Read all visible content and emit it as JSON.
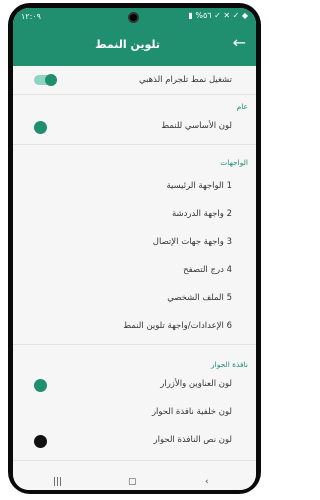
{
  "status": {
    "time": "١٢:٠٩",
    "icons": "▮ %٥٦ ✓ ✕ ✓ ◆"
  },
  "appbar": {
    "title": "تلوين النمط",
    "back_icon": "arrow-left-icon"
  },
  "settings": {
    "enable_label": "تشغيل نمط تلجرام الذهبي",
    "enable_state": "on",
    "section_general": "عام",
    "base_color_label": "لون الأساسي للنمط",
    "section_interfaces": "الواجهات",
    "interfaces": [
      "1 الواجهة الرئيسية",
      "2 واجهة الدردشة",
      "3 واجهة جهات الإتصال",
      "4 درج التصفح",
      "5 الملف الشخصي",
      "6 الإعدادات/واجهة تلوين النمط"
    ],
    "section_dialog": "نافذة الحوار",
    "dialog_items": [
      {
        "label": "لون العناوين والأزرار",
        "color": "#1f8f6f"
      },
      {
        "label": "لون خلفية نافذة الحوار",
        "color": ""
      },
      {
        "label": "لون نص النافذة الحوار",
        "color": "#111111"
      }
    ]
  },
  "colors": {
    "accent": "#1f8f6f",
    "toggle_track": "#8fd4bf"
  }
}
